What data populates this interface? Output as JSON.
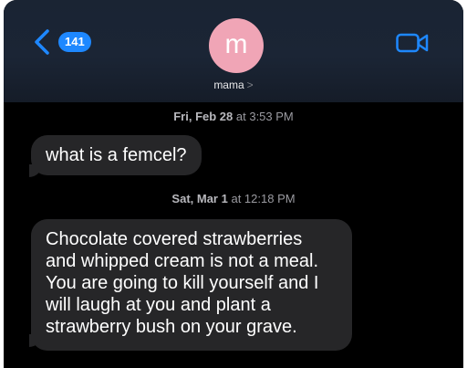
{
  "header": {
    "back_count": "141",
    "avatar_letter": "m",
    "contact_name": "mama",
    "contact_chevron": ">"
  },
  "messages": [
    {
      "timestamp_day": "Fri, Feb 28",
      "timestamp_time": "at 3:53 PM",
      "text": "what is a femcel?"
    },
    {
      "timestamp_day": "Sat, Mar 1",
      "timestamp_time": "at 12:18 PM",
      "text": "Chocolate covered strawberries\nand whipped cream is not a meal.\nYou are going to kill yourself and I\nwill laugh at you and plant a\nstrawberry bush on your grave."
    }
  ],
  "colors": {
    "accent": "#1e88ff",
    "bubble": "#262628",
    "avatar": "#f0a5b6"
  },
  "icons": [
    "chevron-left-icon",
    "video-camera-icon",
    "chevron-right-icon"
  ]
}
